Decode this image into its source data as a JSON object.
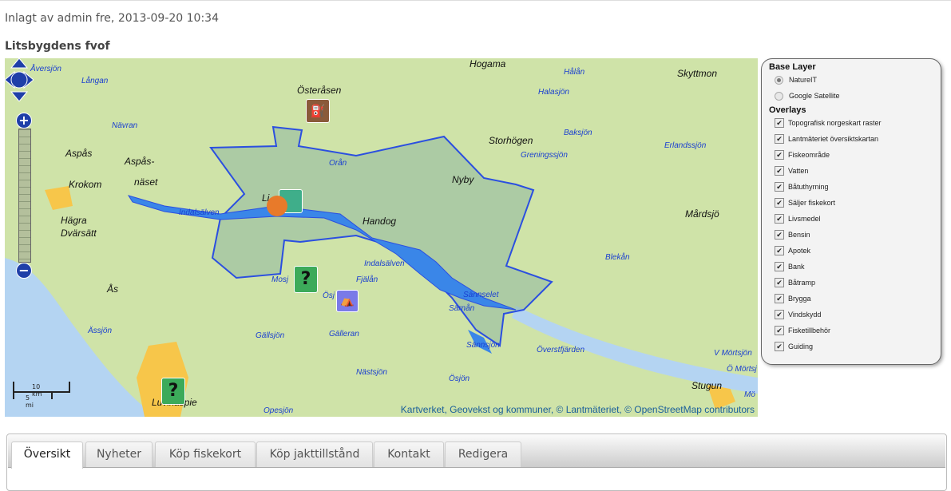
{
  "post_meta": "Inlagt av admin fre, 2013-09-20 10:34",
  "title": "Litsbygdens fvof",
  "map": {
    "attribution": "Kartverket, Geovekst og kommuner, © Lantmäteriet, © OpenStreetMap contributors",
    "scale": {
      "km": "10 km",
      "mi": "5 mi"
    },
    "places": [
      "Hogama",
      "Österåsen",
      "Skyttmon",
      "Aspås",
      "Aspås-",
      "näset",
      "Krokom",
      "Hägra",
      "Dvärsätt",
      "Li",
      "Handog",
      "Nyby",
      "Storhögen",
      "Mårdsjö",
      "Ås",
      "Stugun",
      "Luvikaspie"
    ],
    "waters": [
      "Åversjön",
      "Långan",
      "Nävran",
      "Indalsälven",
      "Orån",
      "Greningssjön",
      "Baksjön",
      "Halasjön",
      "Hålån",
      "Erlandssjön",
      "Indalsälven",
      "Fjälån",
      "Mosj",
      "Ösj",
      "Gällsjön",
      "Gälleran",
      "Sännselet",
      "Särnån",
      "Blekån",
      "Sännsjön",
      "Överstfjärden",
      "Ässjön",
      "Nästsjön",
      "Ösjön",
      "Opesjön",
      "V Mörtsjön",
      "Ö Mörtsj",
      "Mö"
    ]
  },
  "layer_switcher": {
    "base_heading": "Base Layer",
    "base_layers": [
      {
        "label": "NatureIT",
        "selected": true
      },
      {
        "label": "Google Satellite",
        "selected": false
      }
    ],
    "overlay_heading": "Overlays",
    "overlays": [
      {
        "label": "Topografisk norgeskart raster",
        "checked": true
      },
      {
        "label": "Lantmäteriet översiktskartan",
        "checked": true
      },
      {
        "label": "Fiskeområde",
        "checked": true
      },
      {
        "label": "Vatten",
        "checked": true
      },
      {
        "label": "Båtuthyrning",
        "checked": true
      },
      {
        "label": "Säljer fiskekort",
        "checked": true
      },
      {
        "label": "Livsmedel",
        "checked": true
      },
      {
        "label": "Bensin",
        "checked": true
      },
      {
        "label": "Apotek",
        "checked": true
      },
      {
        "label": "Bank",
        "checked": true
      },
      {
        "label": "Båtramp",
        "checked": true
      },
      {
        "label": "Brygga",
        "checked": true
      },
      {
        "label": "Vindskydd",
        "checked": true
      },
      {
        "label": "Fisketillbehör",
        "checked": true
      },
      {
        "label": "Guiding",
        "checked": true
      }
    ]
  },
  "tabs": [
    {
      "label": "Översikt",
      "active": true
    },
    {
      "label": "Nyheter"
    },
    {
      "label": "Köp fiskekort"
    },
    {
      "label": "Köp jakttillstånd"
    },
    {
      "label": "Kontakt"
    },
    {
      "label": "Redigera"
    }
  ],
  "colors": {
    "land": "#cfe3a8",
    "water": "#b4d4f2",
    "area_fill": "#8fb8a0",
    "area_stroke": "#2b4fe0",
    "river": "#3a86e8",
    "urban": "#f7c64a"
  }
}
